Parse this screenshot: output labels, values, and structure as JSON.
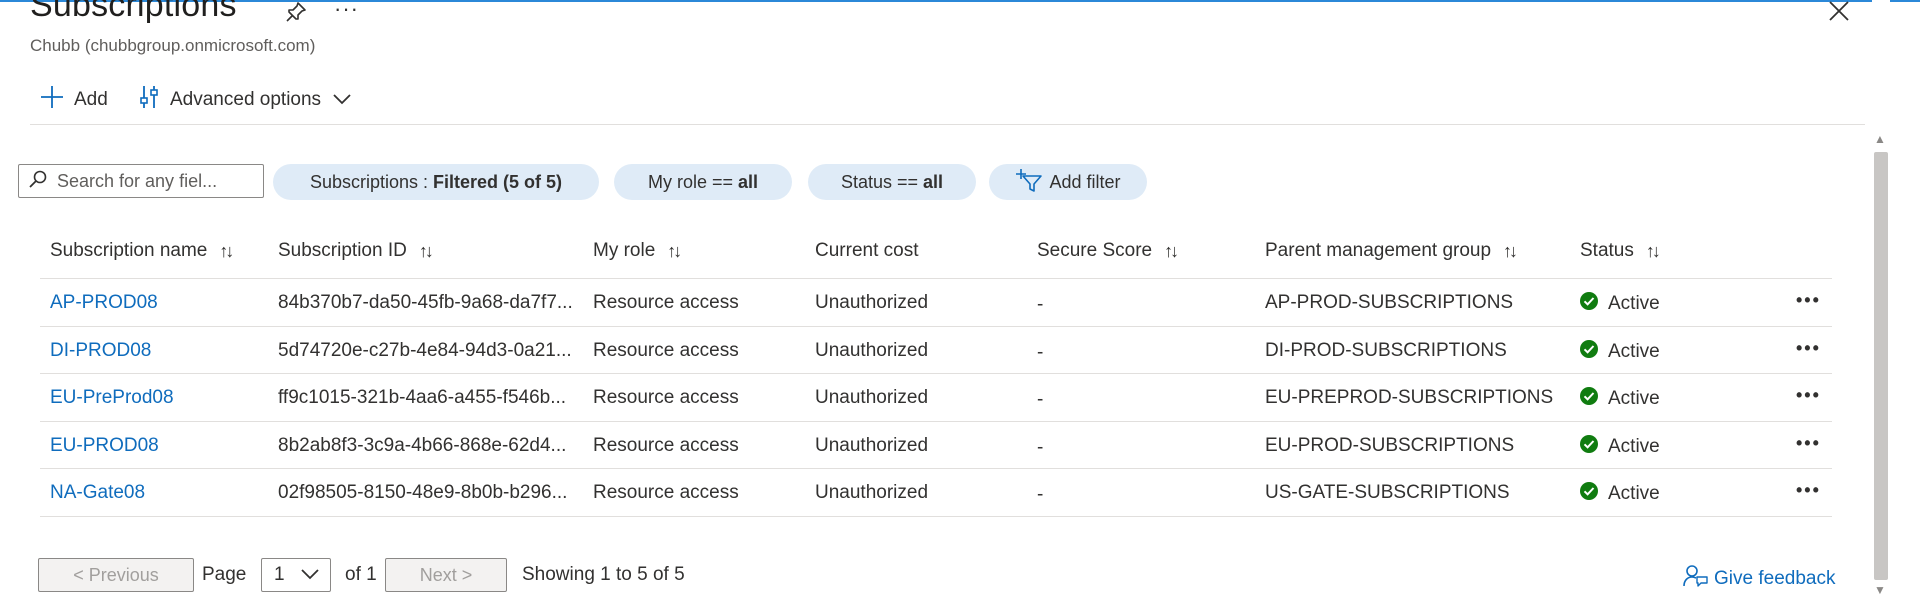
{
  "header": {
    "title": "Subscriptions",
    "subtitle": "Chubb (chubbgroup.onmicrosoft.com)",
    "more": "···"
  },
  "toolbar": {
    "add_label": "Add",
    "advanced_label": "Advanced options"
  },
  "search": {
    "placeholder": "Search for any fiel..."
  },
  "filters": [
    {
      "key": "Subscriptions : ",
      "value": "Filtered (5 of 5)"
    },
    {
      "key": "My role == ",
      "value": "all"
    },
    {
      "key": "Status == ",
      "value": "all"
    }
  ],
  "add_filter_label": "Add filter",
  "columns": [
    "Subscription name",
    "Subscription ID",
    "My role",
    "Current cost",
    "Secure Score",
    "Parent management group",
    "Status"
  ],
  "rows": [
    {
      "name": "AP-PROD08",
      "id": "84b370b7-da50-45fb-9a68-da7f7...",
      "role": "Resource access",
      "cost": "Unauthorized",
      "score": "-",
      "group": "AP-PROD-SUBSCRIPTIONS",
      "status": "Active"
    },
    {
      "name": "DI-PROD08",
      "id": "5d74720e-c27b-4e84-94d3-0a21...",
      "role": "Resource access",
      "cost": "Unauthorized",
      "score": "-",
      "group": "DI-PROD-SUBSCRIPTIONS",
      "status": "Active"
    },
    {
      "name": "EU-PreProd08",
      "id": "ff9c1015-321b-4aa6-a455-f546b...",
      "role": "Resource access",
      "cost": "Unauthorized",
      "score": "-",
      "group": "EU-PREPROD-SUBSCRIPTIONS",
      "status": "Active"
    },
    {
      "name": "EU-PROD08",
      "id": "8b2ab8f3-3c9a-4b66-868e-62d4...",
      "role": "Resource access",
      "cost": "Unauthorized",
      "score": "-",
      "group": "EU-PROD-SUBSCRIPTIONS",
      "status": "Active"
    },
    {
      "name": "NA-Gate08",
      "id": "02f98505-8150-48e9-8b0b-b296...",
      "role": "Resource access",
      "cost": "Unauthorized",
      "score": "-",
      "group": "US-GATE-SUBSCRIPTIONS",
      "status": "Active"
    }
  ],
  "row_more": "•••",
  "pagination": {
    "previous": "< Previous",
    "page_label": "Page",
    "page_value": "1",
    "of_label": "of 1",
    "next": "Next >",
    "showing": "Showing 1 to 5 of 5"
  },
  "feedback_label": "Give feedback",
  "colors": {
    "link": "#0f6cbd",
    "pill": "#dfebf7",
    "status_ok": "#107c10",
    "accent": "#2b88d8"
  }
}
